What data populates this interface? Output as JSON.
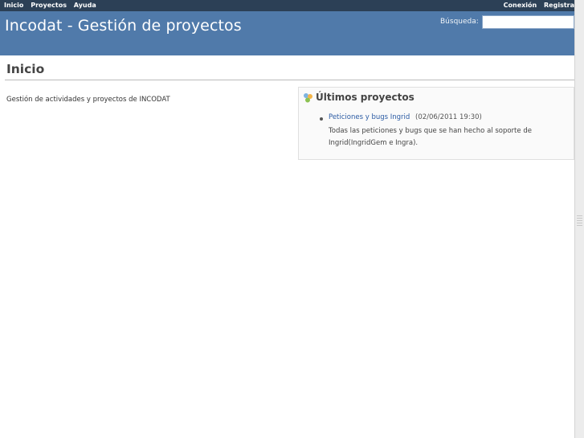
{
  "top_menu": {
    "left_items": [
      "Inicio",
      "Proyectos",
      "Ayuda"
    ],
    "right_items": [
      "Conexión",
      "Registra"
    ]
  },
  "header": {
    "title": "Incodat - Gestión de proyectos",
    "search_label": "Búsqueda:",
    "search_value": ""
  },
  "main": {
    "title": "Inicio",
    "description": "Gestión de actividades y proyectos de INCODAT"
  },
  "latest_projects": {
    "heading": "Últimos proyectos",
    "icon": "projects-icon",
    "items": [
      {
        "name": "Peticiones y bugs Ingrid",
        "date": "(02/06/2011 19:30)",
        "description": "Todas las peticiones y bugs que se han hecho al soporte de Ingrid(IngridGem e Ingra)."
      }
    ]
  }
}
